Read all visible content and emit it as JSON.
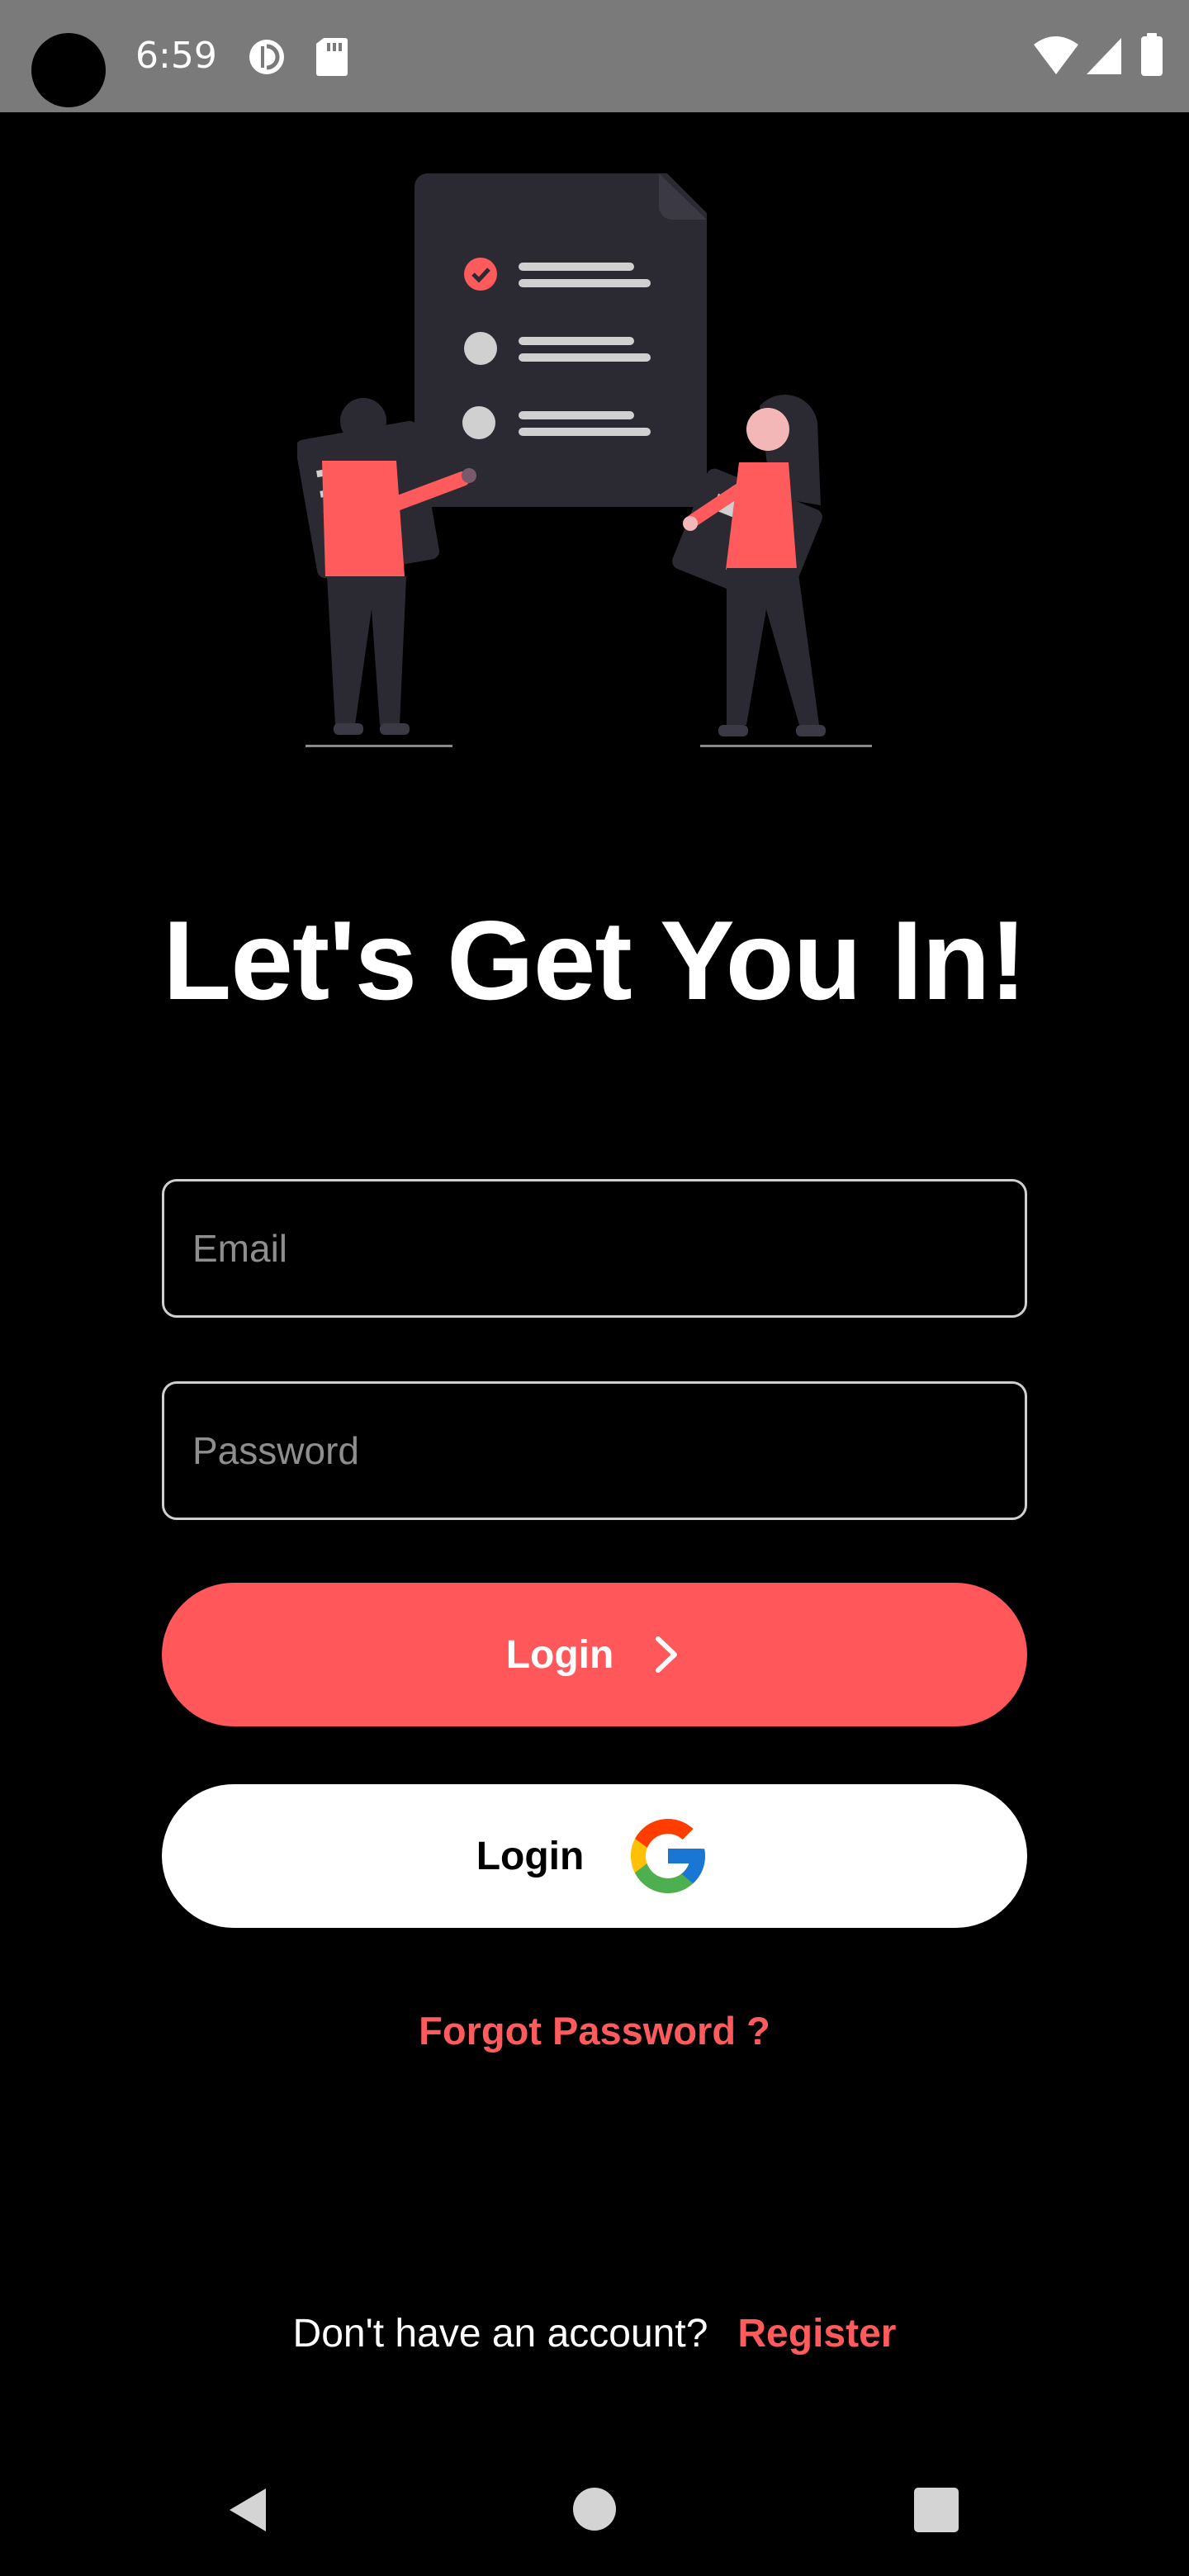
{
  "status_bar": {
    "time": "6:59",
    "left_icons": [
      "camera-dot",
      "data-saver-icon",
      "sd-card-icon"
    ],
    "right_icons": [
      "wifi-icon",
      "signal-icon",
      "battery-icon"
    ]
  },
  "illustration": {
    "name": "checklist-people-illustration",
    "accent_color": "#FF5A5C"
  },
  "title": "Let's Get You In!",
  "email": {
    "placeholder": "Email",
    "value": ""
  },
  "password": {
    "placeholder": "Password",
    "value": ""
  },
  "login_button": {
    "label": "Login",
    "icon": "chevron-right-icon",
    "color": "#FF575A"
  },
  "google_login_button": {
    "label": "Login",
    "icon": "google-icon"
  },
  "forgot_password": "Forgot Password ?",
  "register": {
    "prompt": "Don't have an account?",
    "link": "Register"
  },
  "nav_bar": {
    "icons": [
      "back-icon",
      "home-icon",
      "recents-icon"
    ]
  },
  "colors": {
    "background": "#000000",
    "accent": "#FF5A5C",
    "status_bar": "#7A7A7A"
  }
}
